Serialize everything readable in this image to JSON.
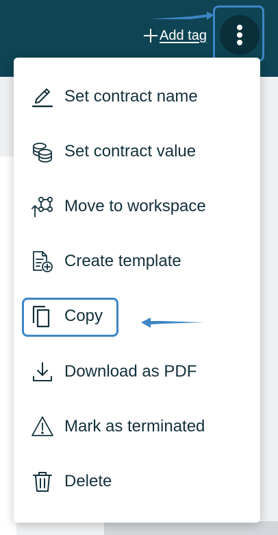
{
  "header": {
    "add_tag_label": "Add tag"
  },
  "menu": {
    "items": [
      {
        "label": "Set contract name",
        "icon": "pencil-icon"
      },
      {
        "label": "Set contract value",
        "icon": "coins-icon"
      },
      {
        "label": "Move to workspace",
        "icon": "workspace-move-icon"
      },
      {
        "label": "Create template",
        "icon": "template-add-icon"
      },
      {
        "label": "Copy",
        "icon": "copy-icon"
      },
      {
        "label": "Download as PDF",
        "icon": "download-icon"
      },
      {
        "label": "Mark as terminated",
        "icon": "warning-icon"
      },
      {
        "label": "Delete",
        "icon": "trash-icon"
      }
    ]
  },
  "colors": {
    "topbar": "#0e4453",
    "more_button": "#0a2f3a",
    "highlight": "#3d86c6",
    "text": "#13303c"
  }
}
